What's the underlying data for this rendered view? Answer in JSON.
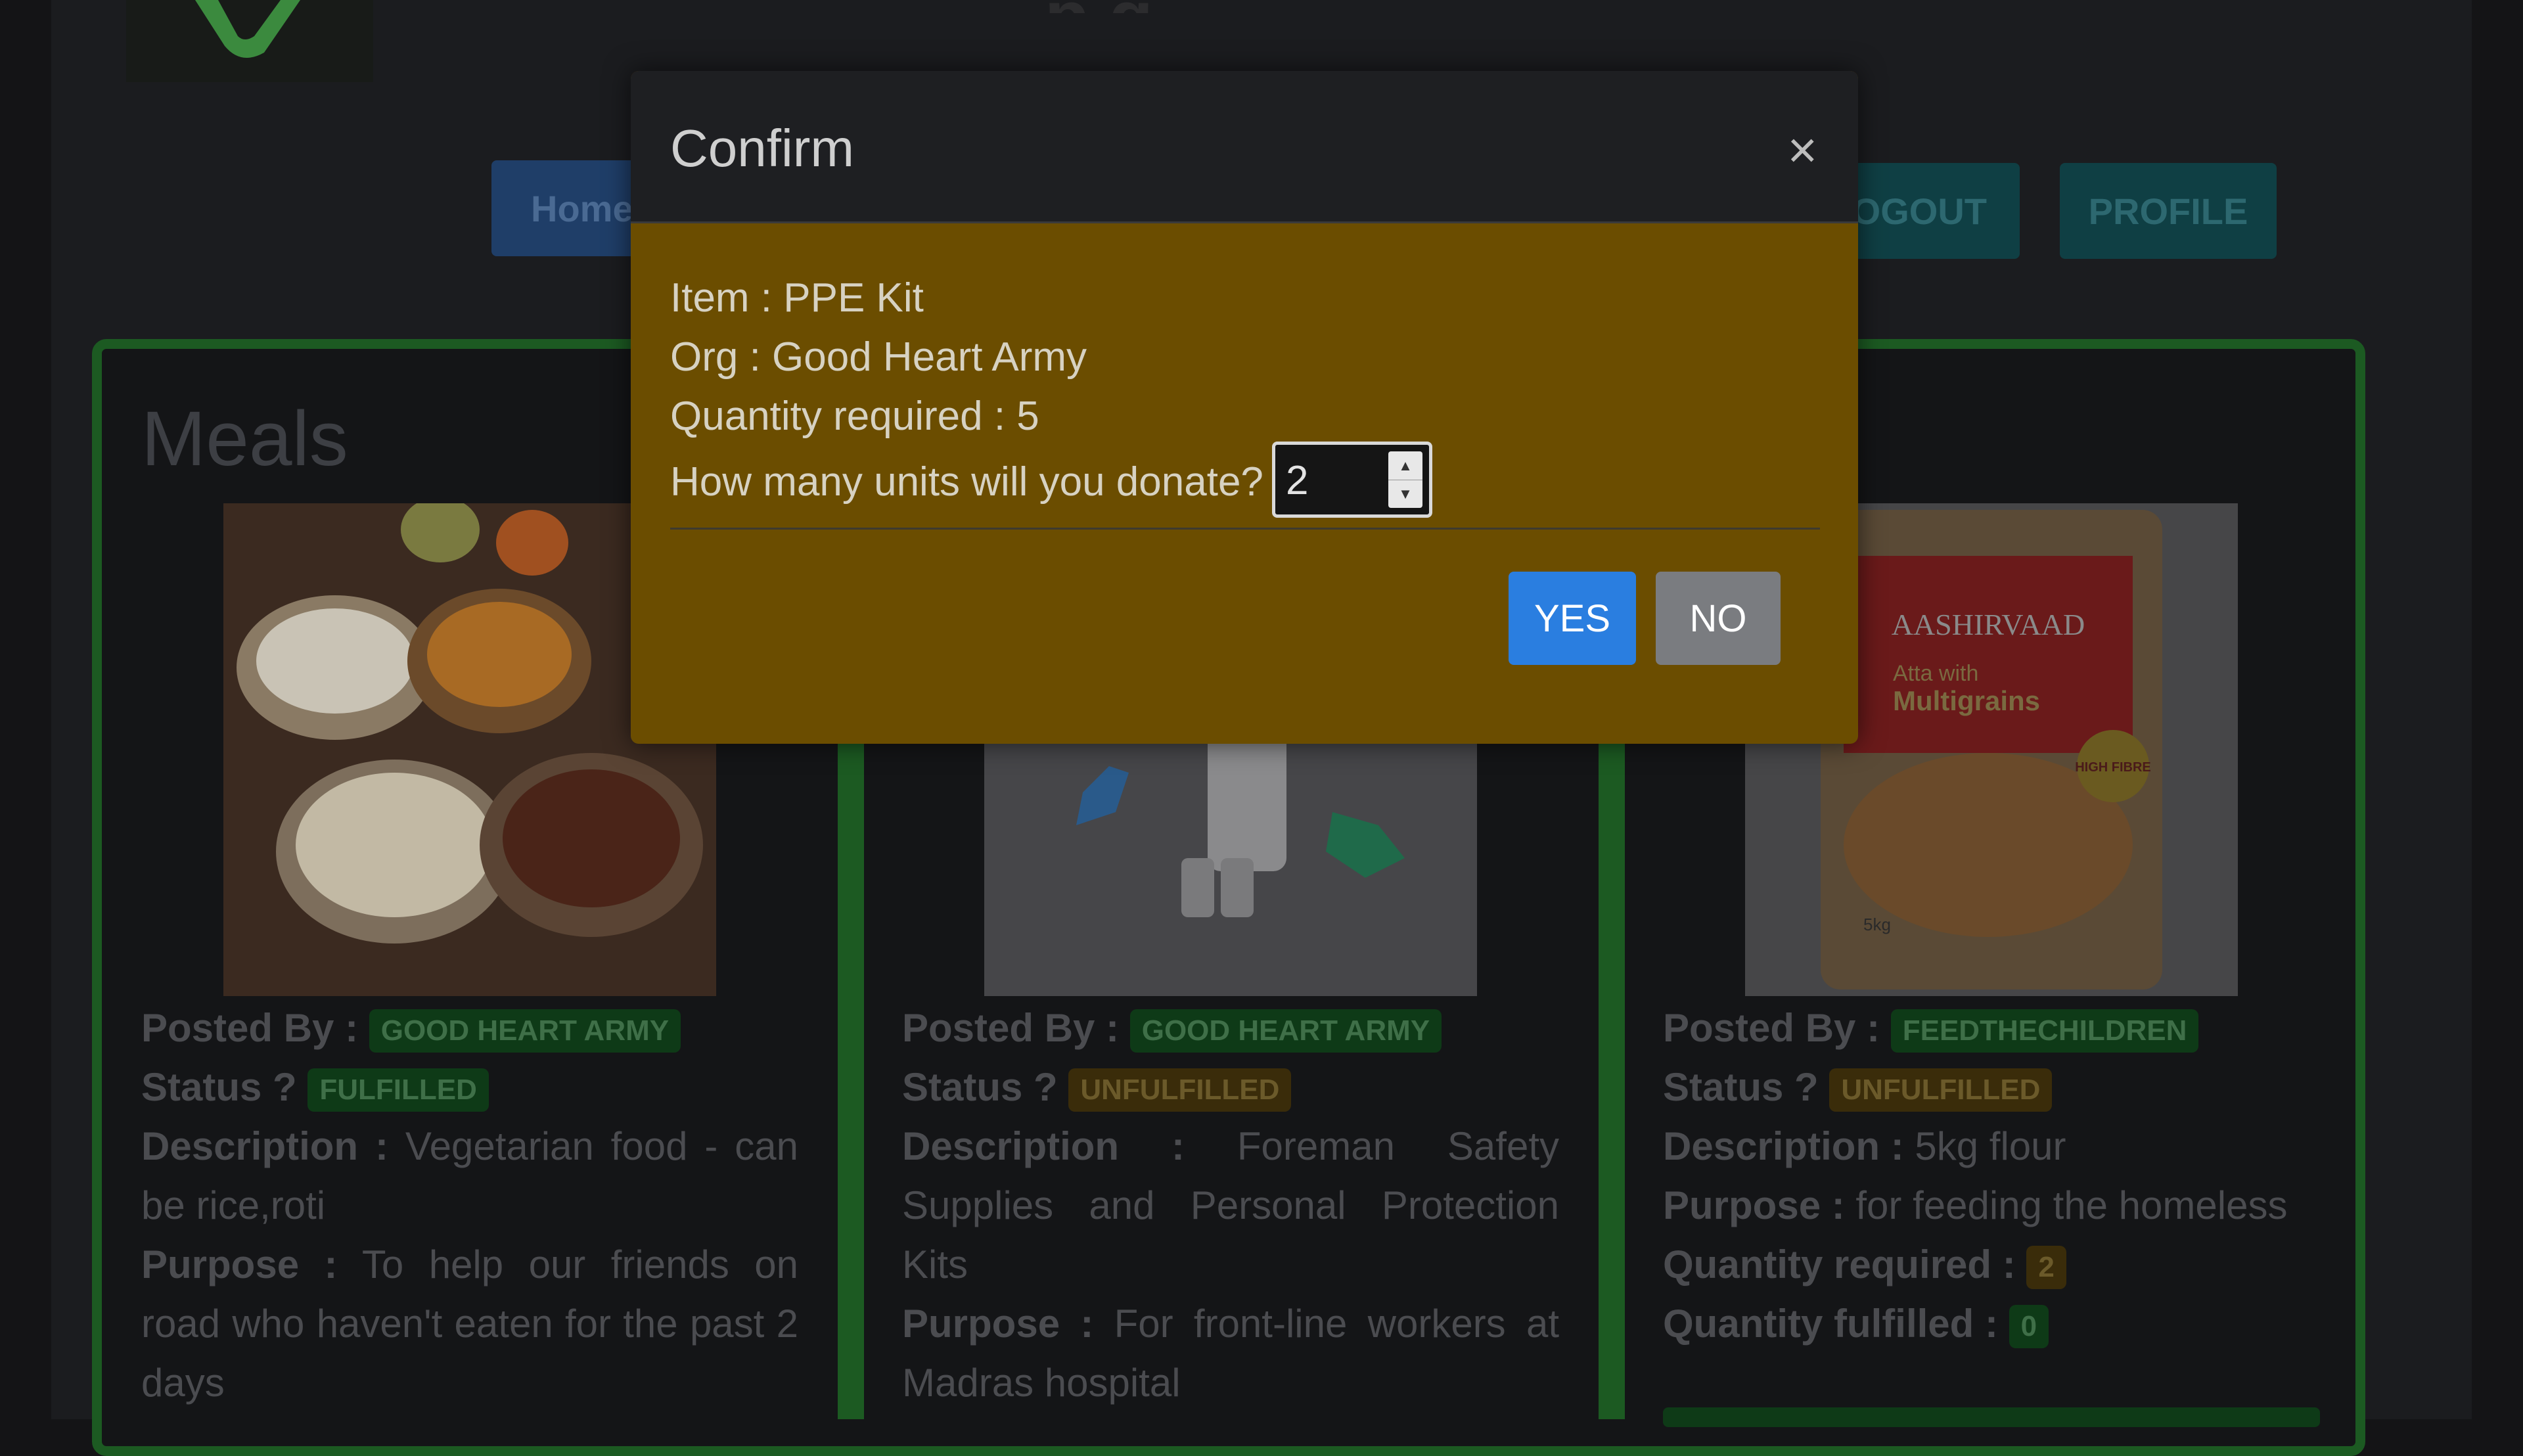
{
  "site": {
    "title_fragment": "p   g"
  },
  "nav": {
    "home": "Home",
    "logout": "LOGOUT",
    "profile": "PROFILE"
  },
  "section": {
    "title": "Meals"
  },
  "cards": [
    {
      "posted_by_label": "Posted By :",
      "posted_by": "GOOD HEART ARMY",
      "status_label": "Status ?",
      "status": "FULFILLED",
      "description_label": "Description :",
      "description": "Vegetarian food - can be rice,roti",
      "purpose_label": "Purpose :",
      "purpose": "To help our friends on road who haven't eaten for the past 2 days"
    },
    {
      "posted_by_label": "Posted By :",
      "posted_by": "GOOD HEART ARMY",
      "status_label": "Status ?",
      "status": "UNFULFILLED",
      "description_label": "Description :",
      "description": "Foreman Safety Supplies and Personal Protection Kits",
      "purpose_label": "Purpose :",
      "purpose": "For front-line workers at Madras hospital"
    },
    {
      "posted_by_label": "Posted By :",
      "posted_by": "FEEDTHECHILDREN",
      "status_label": "Status ?",
      "status": "UNFULFILLED",
      "description_label": "Description :",
      "description": "5kg flour",
      "purpose_label": "Purpose :",
      "purpose": "for feeding the homeless",
      "qty_required_label": "Quantity required :",
      "qty_required": "2",
      "qty_fulfilled_label": "Quantity fulfilled :",
      "qty_fulfilled": "0",
      "package_brand": "AASHIRVAAD",
      "package_line1": "Atta with",
      "package_line2": "Multigrains",
      "package_badge": "HIGH FIBRE",
      "package_weight": "5kg"
    }
  ],
  "modal": {
    "title": "Confirm",
    "close": "×",
    "item": "Item : PPE Kit",
    "org": "Org : Good Heart Army",
    "quantity_required": "Quantity required : 5",
    "question": "How many units will you donate?",
    "quantity_value": "2",
    "yes": "YES",
    "no": "NO"
  },
  "colors": {
    "primary": "#2a7ee0",
    "modal_body": "#6b4d00",
    "accent_green": "#1c5a22"
  }
}
